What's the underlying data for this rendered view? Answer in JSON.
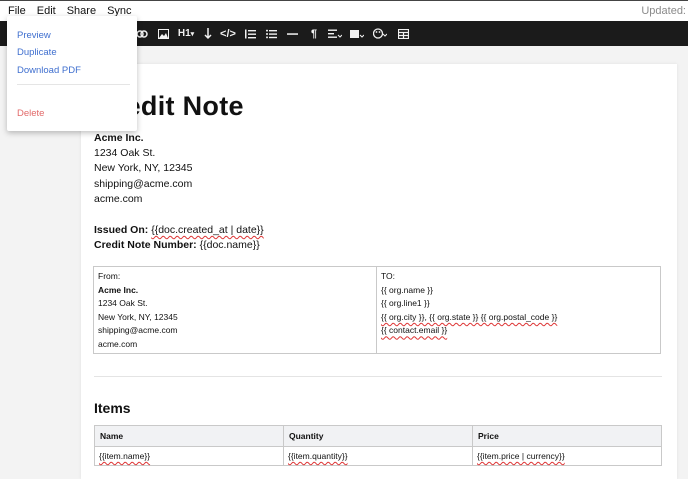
{
  "menu": {
    "file": "File",
    "edit": "Edit",
    "share": "Share",
    "sync": "Sync",
    "updated": "Updated:"
  },
  "toolbar": {
    "icons": [
      "link-icon",
      "image-icon",
      "heading-icon",
      "line-break-icon",
      "code-icon",
      "ordered-list-icon",
      "bullet-list-icon",
      "horizontal-rule-icon",
      "paragraph-icon",
      "align-icon",
      "media-icon",
      "color-palette-icon",
      "table-icon"
    ],
    "heading_label": "H1"
  },
  "file_menu": {
    "preview": "Preview",
    "duplicate": "Duplicate",
    "download_pdf": "Download PDF",
    "delete": "Delete"
  },
  "document": {
    "title": "Credit Note",
    "company": {
      "name": "Acme Inc.",
      "street": "1234 Oak St.",
      "city": "New York, NY, 12345",
      "email": "shipping@acme.com",
      "website": "acme.com"
    },
    "issued_label": "Issued On:",
    "issued_value": "{{doc.created_at | date}}",
    "number_label": "Credit Note Number:",
    "number_value": "{{doc.name}}",
    "from": {
      "label": "From:",
      "name": "Acme Inc.",
      "street": "1234 Oak St.",
      "city": "New York, NY, 12345",
      "email": "shipping@acme.com",
      "website": "acme.com"
    },
    "to": {
      "label": "TO:",
      "line1": "{{ org.name }}",
      "line2": "{{ org.line1 }}",
      "line3": "{{ org.city }}, {{ org.state }} {{ org.postal_code }}",
      "line4": "{{ contact.email }}"
    },
    "items_heading": "Items",
    "items_columns": [
      "Name",
      "Quantity",
      "Price"
    ],
    "items_row": [
      "{{item.name}}",
      "{{item.quantity}}",
      "{{item.price | currency}}"
    ]
  }
}
